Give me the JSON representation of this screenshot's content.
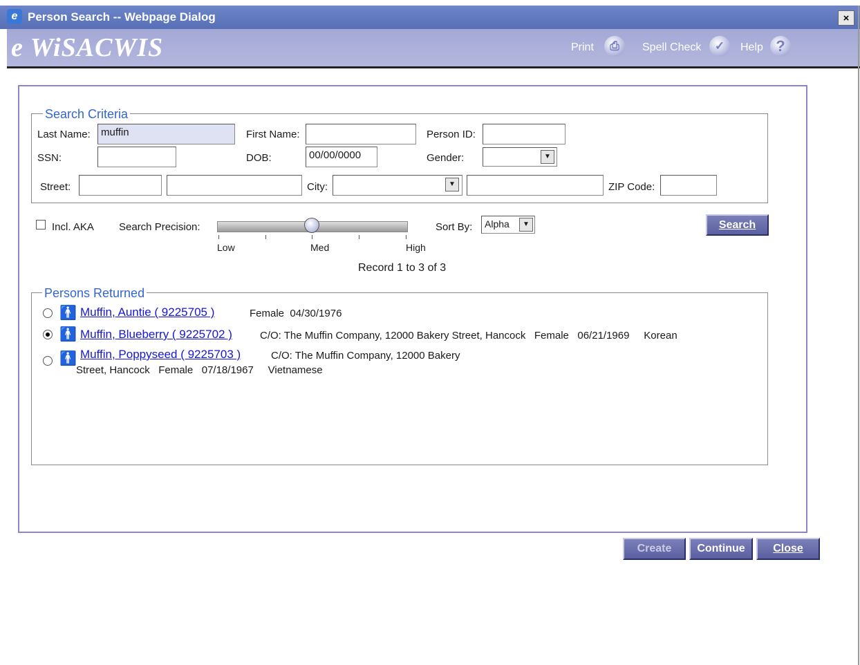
{
  "window": {
    "title": "Person Search -- Webpage Dialog",
    "close_glyph": "×",
    "app_icon": "e"
  },
  "banner": {
    "logo": "e WiSACWIS",
    "print_label": "Print",
    "spell_check_label": "Spell Check",
    "help_label": "Help",
    "help_glyph": "?",
    "print_glyph": "⎙",
    "spell_glyph": "✓"
  },
  "search_criteria": {
    "legend": "Search Criteria",
    "last_name_label": "Last Name:",
    "last_name_value": "muffin",
    "first_name_label": "First Name:",
    "first_name_value": "",
    "person_id_label": "Person ID:",
    "person_id_value": "",
    "ssn_label": "SSN:",
    "ssn_value": "",
    "dob_label": "DOB:",
    "dob_value": "00/00/0000",
    "gender_label": "Gender:",
    "gender_value": "",
    "street_label": "Street:",
    "street_number_value": "",
    "street_name_value": "",
    "city_label": "City:",
    "city_value": "",
    "city_extra_value": "",
    "zip_label": "ZIP Code:",
    "zip_value": ""
  },
  "options": {
    "incl_aka_label": "Incl. AKA",
    "incl_aka_checked": false,
    "precision_label": "Search Precision:",
    "precision_ticks": [
      "Low",
      "Med",
      "High"
    ],
    "precision_level": "Med",
    "sort_by_label": "Sort By:",
    "sort_by_value": "Alpha",
    "search_button": "Search"
  },
  "record_count": "Record 1 to 3 of 3",
  "results": {
    "legend": "Persons Returned",
    "rows": [
      {
        "selected": false,
        "name_link": "Muffin, Auntie ( 9225705 )",
        "details": "Female  04/30/1976",
        "details2": ""
      },
      {
        "selected": true,
        "name_link": "Muffin, Blueberry ( 9225702 )",
        "details": "C/O: The Muffin Company, 12000 Bakery Street, Hancock   Female   06/21/1969     Korean",
        "details2": ""
      },
      {
        "selected": false,
        "name_link": "Muffin, Poppyseed ( 9225703 )",
        "details": "C/O: The Muffin Company, 12000 Bakery",
        "details2": "Street, Hancock   Female   07/18/1967     Vietnamese"
      }
    ]
  },
  "footer_buttons": {
    "create": "Create",
    "continue": "Continue",
    "close": "Close"
  },
  "icons": {
    "dropdown_arrow": "▼",
    "person": "🚹"
  },
  "colors": {
    "titlebar": "#566fb6",
    "banner": "#a3a8d6",
    "legend": "#3366cc",
    "link": "#1515d8",
    "button": "#5a5fa0"
  }
}
